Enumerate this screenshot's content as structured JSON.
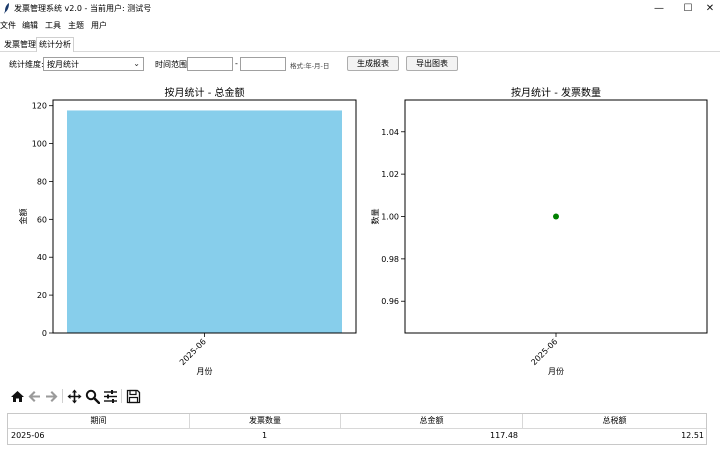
{
  "window": {
    "title": "发票管理系统 v2.0 - 当前用户: 测试号",
    "minimize_glyph": "—",
    "maximize_glyph": "☐",
    "close_glyph": "✕"
  },
  "menu": [
    "文件",
    "编辑",
    "工具",
    "主题",
    "用户"
  ],
  "tabs": [
    {
      "label": "发票管理",
      "active": false
    },
    {
      "label": "统计分析",
      "active": true
    }
  ],
  "filters": {
    "dimension_label": "统计维度:",
    "dimension_value": "按月统计",
    "time_range_label": "时间范围:",
    "start_value": "",
    "separator": "-",
    "end_value": "",
    "format_hint": "格式:年-月-日",
    "generate_button": "生成报表",
    "export_button": "导出图表"
  },
  "chart_data": [
    {
      "type": "bar",
      "title": "按月统计 - 总金额",
      "xlabel": "月份",
      "ylabel": "金额",
      "categories": [
        "2025-06"
      ],
      "values": [
        117.48
      ],
      "ylim": [
        0,
        123
      ],
      "yticks": [
        0,
        20,
        40,
        60,
        80,
        100,
        120
      ],
      "color": "#87ceeb",
      "grid": false
    },
    {
      "type": "scatter",
      "title": "按月统计 - 发票数量",
      "xlabel": "月份",
      "ylabel": "数量",
      "categories": [
        "2025-06"
      ],
      "values": [
        1
      ],
      "ylim": [
        0.945,
        1.055
      ],
      "yticks": [
        0.96,
        0.98,
        1.0,
        1.02,
        1.04
      ],
      "color": "#008000",
      "grid": false
    }
  ],
  "toolbar": [
    "home-icon",
    "back-icon",
    "forward-icon",
    "pan-icon",
    "zoom-icon",
    "configure-icon",
    "save-icon"
  ],
  "table": {
    "headers": [
      "期间",
      "发票数量",
      "总金额",
      "总税额"
    ],
    "rows": [
      [
        "2025-06",
        "1",
        "117.48",
        "12.51"
      ]
    ]
  }
}
